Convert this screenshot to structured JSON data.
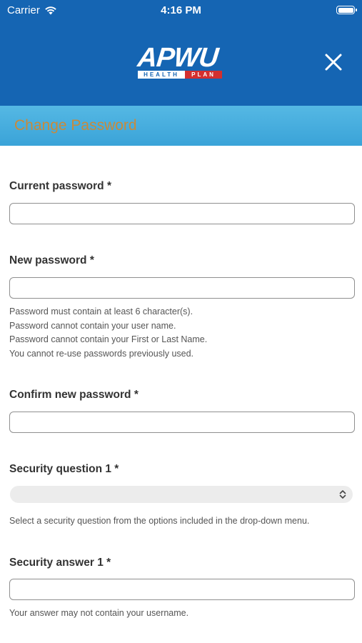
{
  "status_bar": {
    "carrier": "Carrier",
    "time": "4:16 PM"
  },
  "header": {
    "logo_main": "APWU",
    "logo_health": "HEALTH",
    "logo_plan": "PLAN"
  },
  "page_title": "Change Password",
  "form": {
    "current_password": {
      "label": "Current password *",
      "value": ""
    },
    "new_password": {
      "label": "New password *",
      "value": "",
      "help": [
        "Password must contain at least 6 character(s).",
        "Password cannot contain your user name.",
        "Password cannot contain your First or Last Name.",
        "You cannot re-use passwords previously used."
      ]
    },
    "confirm_password": {
      "label": "Confirm new password *",
      "value": ""
    },
    "security_question_1": {
      "label": "Security question 1 *",
      "selected": "",
      "help": "Select a security question from the options included in the drop-down menu."
    },
    "security_answer_1": {
      "label": "Security answer 1 *",
      "value": "",
      "help": "Your answer may not contain your username."
    }
  },
  "colors": {
    "header_blue": "#1565b3",
    "title_band": "#3aa3d8",
    "title_text": "#c98a3a",
    "plan_red": "#d32f2f"
  }
}
